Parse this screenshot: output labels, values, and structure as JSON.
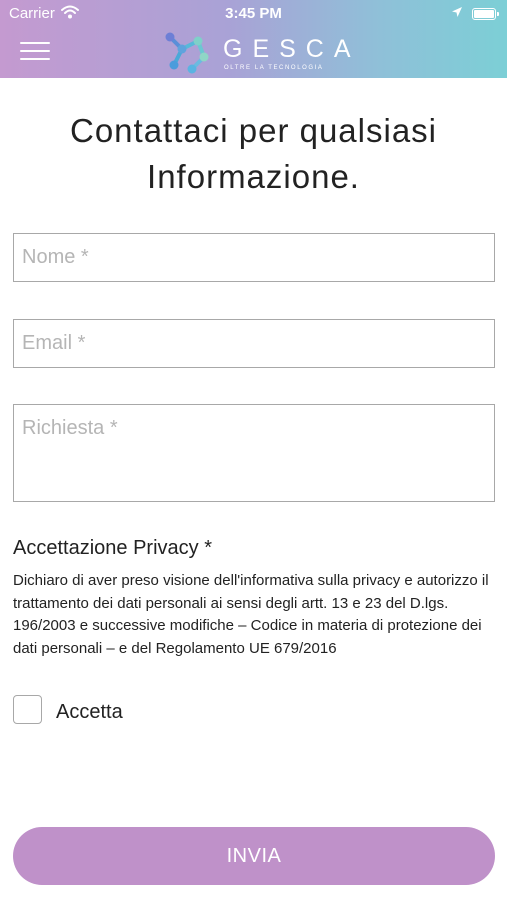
{
  "status_bar": {
    "carrier": "Carrier",
    "time": "3:45 PM"
  },
  "header": {
    "menu_icon": "hamburger-icon",
    "brand": "GESCA",
    "tagline": "OLTRE LA TECNOLOGIA",
    "gradient_colors": [
      "#c49ad0",
      "#7ccfd6"
    ]
  },
  "page": {
    "title_line1": "Contattaci per qualsiasi",
    "title_line2": "Informazione."
  },
  "form": {
    "name_placeholder": "Nome *",
    "email_placeholder": "Email *",
    "request_placeholder": "Richiesta *",
    "privacy_title": "Accettazione Privacy *",
    "privacy_text": "Dichiaro di aver preso visione dell'informativa sulla privacy e autorizzo il trattamento dei dati personali ai sensi degli artt. 13 e 23 del D.lgs. 196/2003 e successive modifiche – Codice in materia di protezione dei dati personali – e del Regolamento UE 679/2016",
    "accept_label": "Accetta",
    "accept_checked": false,
    "submit_label": "INVIA",
    "submit_color": "#bf91c9"
  }
}
